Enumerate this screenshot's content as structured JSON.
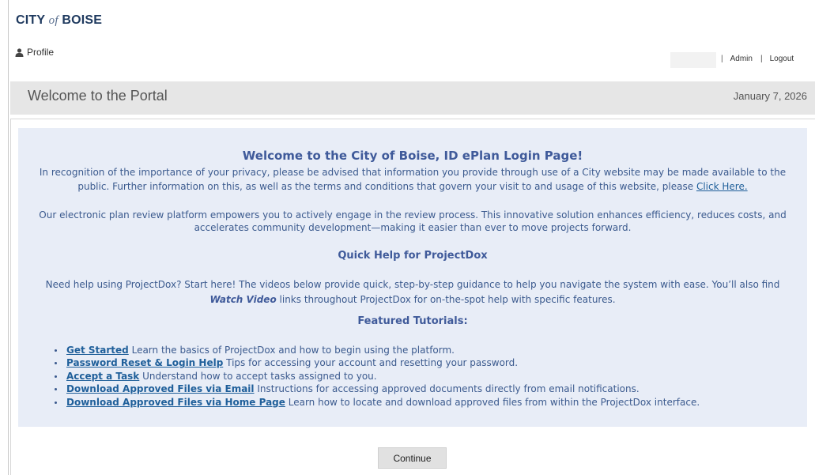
{
  "header": {
    "logo_city": "CITY",
    "logo_of": "of",
    "logo_boise": "BOISE",
    "profile_label": "Profile",
    "admin_link": "Admin",
    "logout_link": "Logout",
    "separator": "|"
  },
  "banner": {
    "title": "Welcome to the Portal",
    "date": "January 7, 2026"
  },
  "panel": {
    "heading": "Welcome to the City of Boise, ID ePlan Login Page!",
    "privacy_text": "In recognition of the importance of your privacy, please be advised that information you provide through use of a City website may be made available to the public. Further information on this, as well as the terms and conditions that govern your visit to and usage of this website, please",
    "privacy_link": "Click Here.",
    "platform_text": "Our electronic plan review platform empowers you to actively engage in the review process. This innovative solution enhances efficiency, reduces costs, and accelerates community development—making it easier than ever to move projects forward.",
    "quick_help_heading": "Quick Help for ProjectDox",
    "help_text_1": "Need help using ProjectDox? Start here! The videos below provide quick, step-by-step guidance to help you navigate the system with ease. You’ll also find",
    "watch_video": "Watch Video",
    "help_text_2": "links throughout ProjectDox for on-the-spot help with specific features.",
    "tutorials_heading": "Featured Tutorials:",
    "tutorials": [
      {
        "link": "Get Started",
        "desc": "Learn the basics of ProjectDox and how to begin using the platform."
      },
      {
        "link": "Password Reset & Login Help",
        "desc": "Tips for accessing your account and resetting your password."
      },
      {
        "link": "Accept a Task",
        "desc": "Understand how to accept tasks assigned to you."
      },
      {
        "link": "Download Approved Files via Email",
        "desc": "Instructions for accessing approved documents directly from email notifications."
      },
      {
        "link": "Download Approved Files via Home Page",
        "desc": "Learn how to locate and download approved files from within the ProjectDox interface."
      }
    ]
  },
  "continue_button": "Continue",
  "icons": {
    "profile": "user-icon"
  },
  "colors": {
    "heading": "#3f5a9a",
    "link": "#1f5f9a",
    "panel_bg": "#e8edf7",
    "banner_bg": "#e6e6e6"
  }
}
